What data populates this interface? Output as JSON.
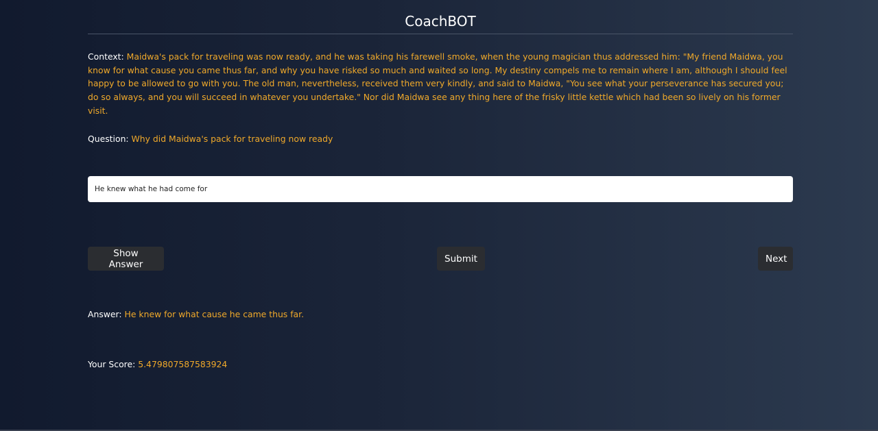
{
  "app": {
    "title": "CoachBOT"
  },
  "context": {
    "label": "Context:",
    "text": "Maidwa's pack for traveling was now ready, and he was taking his farewell smoke, when the young magician thus addressed him: \"My friend Maidwa, you know for what cause you came thus far, and why you have risked so much and waited so long. My destiny compels me to remain where I am, although I should feel happy to be allowed to go with you. The old man, nevertheless, received them very kindly, and said to Maidwa, \"You see what your perseverance has secured you; do so always, and you will succeed in whatever you undertake.\" Nor did Maidwa see any thing here of the frisky little kettle which had been so lively on his former visit."
  },
  "question": {
    "label": "Question:",
    "text": "Why did Maidwa's pack for traveling now ready"
  },
  "input": {
    "value": "He knew what he had come for",
    "placeholder": ""
  },
  "buttons": {
    "show_answer": "Show Answer",
    "submit": "Submit",
    "next": "Next"
  },
  "answer": {
    "label": "Answer:",
    "text": "He knew for what cause he came thus far."
  },
  "score": {
    "label": "Your Score:",
    "value": "5.479807587583924"
  },
  "colors": {
    "accent": "#f0a92a",
    "button_bg": "#2b2d31",
    "background_start": "#111a2e",
    "background_end": "#2c3a4f"
  }
}
